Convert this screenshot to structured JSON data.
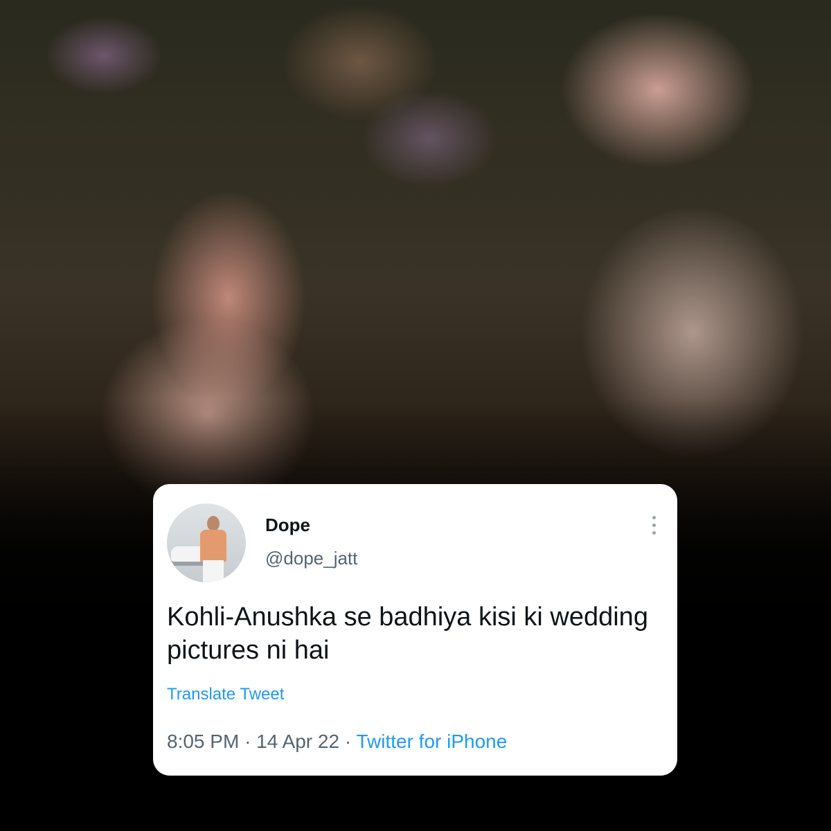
{
  "tweet": {
    "display_name": "Dope",
    "handle": "@dope_jatt",
    "text": "Kohli-Anushka se badhiya kisi ki wedding pictures ni hai",
    "translate_label": "Translate Tweet",
    "time": "8:05 PM",
    "date": "14 Apr 22",
    "source": "Twitter for iPhone",
    "separator": "·"
  },
  "colors": {
    "link": "#1d9bf0",
    "secondary_text": "#536471",
    "primary_text": "#0f1419"
  },
  "icons": {
    "more": "more-vertical-icon"
  }
}
